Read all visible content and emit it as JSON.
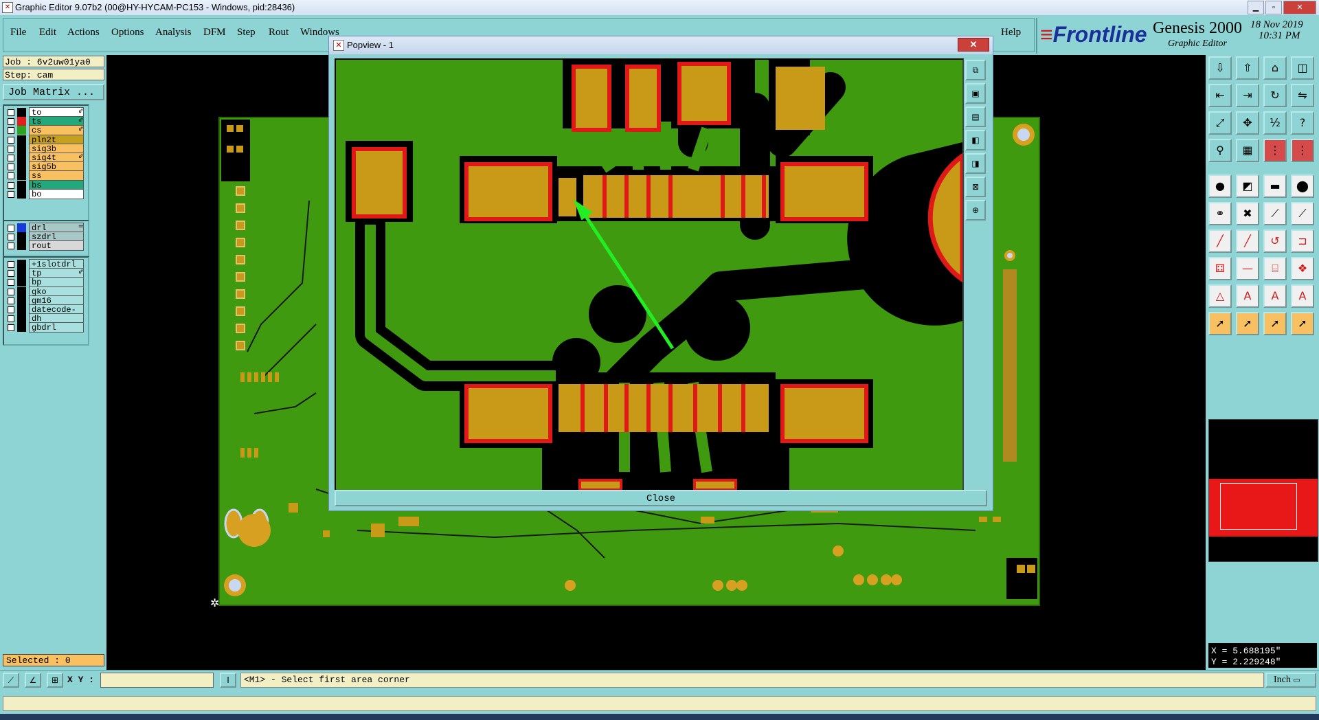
{
  "window": {
    "title": "Graphic Editor 9.07b2 (00@HY-HYCAM-PC153 - Windows, pid:28436)",
    "icon": "x-icon",
    "controls": [
      "minimize-icon",
      "maximize-icon",
      "close-icon"
    ]
  },
  "menus": [
    {
      "label": "File"
    },
    {
      "label": "Edit"
    },
    {
      "label": "Actions"
    },
    {
      "label": "Options"
    },
    {
      "label": "Analysis"
    },
    {
      "label": "DFM"
    },
    {
      "label": "Step"
    },
    {
      "label": "Rout"
    },
    {
      "label": "Windows"
    },
    {
      "label": "Help"
    }
  ],
  "brand": {
    "logo": "Frontline",
    "product": "Genesis 2000",
    "subtitle": "Graphic Editor",
    "date": "18 Nov 2019",
    "time": "10:31 PM"
  },
  "job": {
    "job_line": "Job : 6v2uw01ya0",
    "step_line": "Step: cam",
    "matrix_button": "Job Matrix ..."
  },
  "layers_group1": [
    {
      "name": "to",
      "swatch": "#000000",
      "bg": "#ffffff",
      "mark": "⇙"
    },
    {
      "name": "ts",
      "swatch": "#e02020",
      "bg": "#22a87a",
      "mark": "⇙"
    },
    {
      "name": "cs",
      "swatch": "#2fa020",
      "bg": "#f8c060",
      "mark": "⇙"
    },
    {
      "name": "pln2t",
      "swatch": "#000000",
      "bg": "#c8a020",
      "mark": ""
    },
    {
      "name": "sig3b",
      "swatch": "#000000",
      "bg": "#f8c060",
      "mark": ""
    },
    {
      "name": "sig4t",
      "swatch": "#000000",
      "bg": "#f8c060",
      "mark": "⇙"
    },
    {
      "name": "sig5b",
      "swatch": "#000000",
      "bg": "#f8c060",
      "mark": ""
    },
    {
      "name": "ss",
      "swatch": "#000000",
      "bg": "#f8c060",
      "mark": ""
    },
    {
      "name": "bs",
      "swatch": "#000000",
      "bg": "#22a87a",
      "mark": ""
    },
    {
      "name": "bo",
      "swatch": "#000000",
      "bg": "#ffffff",
      "mark": ""
    }
  ],
  "layers_group2": [
    {
      "name": "drl",
      "swatch": "#1a3ad8",
      "bg": "#a8c8c8",
      "mark": "="
    },
    {
      "name": "szdrl",
      "swatch": "#000000",
      "bg": "#a8c8c8",
      "mark": ""
    },
    {
      "name": "rout",
      "swatch": "#000000",
      "bg": "#d8d8d8",
      "mark": ""
    }
  ],
  "layers_group3": [
    {
      "name": "+1slotdrl",
      "swatch": "#000000",
      "bg": "#a8e0e0",
      "mark": ""
    },
    {
      "name": "tp",
      "swatch": "#000000",
      "bg": "#a8e0e0",
      "mark": "⇙"
    },
    {
      "name": "bp",
      "swatch": "#000000",
      "bg": "#a8e0e0",
      "mark": ""
    },
    {
      "name": "gko",
      "swatch": "#000000",
      "bg": "#a8e0e0",
      "mark": ""
    },
    {
      "name": "gm16",
      "swatch": "#000000",
      "bg": "#a8e0e0",
      "mark": ""
    },
    {
      "name": "datecode-to",
      "swatch": "#000000",
      "bg": "#a8e0e0",
      "mark": ""
    },
    {
      "name": "dh",
      "swatch": "#000000",
      "bg": "#a8e0e0",
      "mark": ""
    },
    {
      "name": "gbdrl",
      "swatch": "#000000",
      "bg": "#a8e0e0",
      "mark": ""
    }
  ],
  "selected": "Selected : 0",
  "popview": {
    "title": "Popview - 1",
    "close_label": "Close",
    "side_buttons": [
      "popview-fit-icon",
      "zoom-in-icon",
      "zoom-out-icon",
      "pan-left-icon",
      "pan-right-icon",
      "snap-icon",
      "center-icon"
    ]
  },
  "toolbox": [
    [
      "save-icon",
      "load-icon",
      "home-icon",
      "window-icon"
    ],
    [
      "import-icon",
      "export-icon",
      "rotate-icon",
      "mirror-icon"
    ],
    [
      "fit-icon",
      "expand-icon",
      "ratio-icon",
      "help-icon"
    ],
    [
      "measure-icon",
      "grid-icon",
      "traffic-icon",
      "traffic2-icon"
    ],
    [
      "pad-icon",
      "cursor-box-icon",
      "ruler-icon",
      "point-icon"
    ],
    [
      "net-icon",
      "cross-icon",
      "line-pt-icon",
      "line-pt2-icon"
    ],
    [
      "line-icon",
      "slash-icon",
      "arc-icon",
      "shape-icon"
    ],
    [
      "pads-icon",
      "dash-icon",
      "bracket-icon",
      "multi-icon"
    ],
    [
      "triangle-icon",
      "text-a-icon",
      "text-a2-icon",
      "text-a3-icon"
    ],
    [
      "pointer-icon",
      "pointer2-icon",
      "pointer3-icon",
      "pointer-step-icon"
    ]
  ],
  "coords": {
    "x": "X = 5.688195\"",
    "y": "Y = 2.229248\""
  },
  "bottom": {
    "xy_label": "X Y :",
    "xy_value": "",
    "info_icon": "I",
    "prompt": "<M1> - Select first area corner",
    "units": "Inch"
  },
  "colors": {
    "board": "#3f9a10",
    "copper": "#c89a18",
    "pad_outline": "#e01818",
    "panel": "#8fd4d4"
  }
}
